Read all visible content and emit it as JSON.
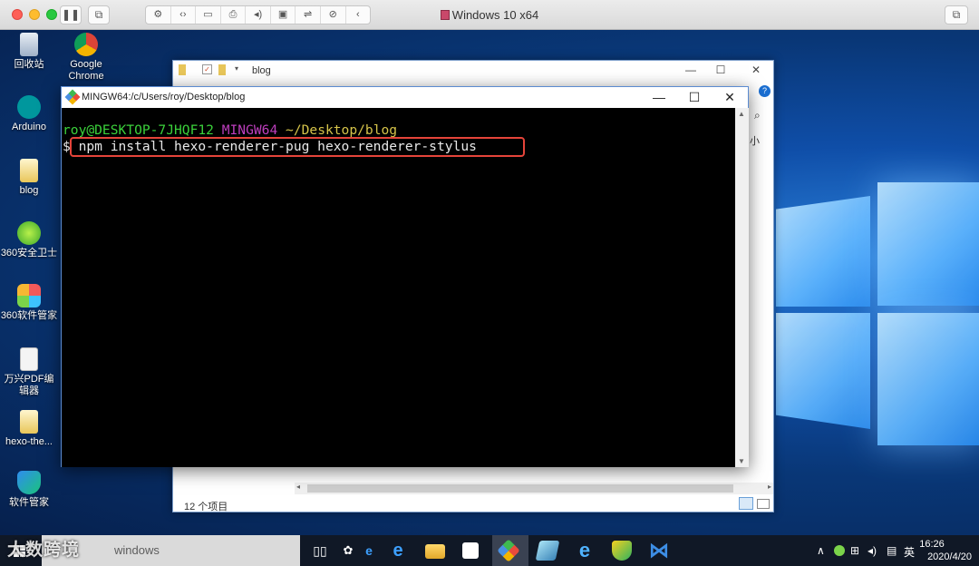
{
  "vm": {
    "title": "Windows 10 x64"
  },
  "desktop": {
    "icons": [
      {
        "label": "回收站"
      },
      {
        "label": "Google Chrome"
      },
      {
        "label": "Arduino"
      },
      {
        "label": "blog"
      },
      {
        "label": "360安全卫士"
      },
      {
        "label": "360软件管家"
      },
      {
        "label": "万兴PDF编辑器"
      },
      {
        "label": "hexo-the..."
      },
      {
        "label": "软件管家"
      }
    ]
  },
  "explorer": {
    "title": "blog",
    "side_char": "小",
    "status": "12 个项目"
  },
  "terminal": {
    "title": "MINGW64:/c/Users/roy/Desktop/blog",
    "prompt_user": "roy@DESKTOP-7JHQF12",
    "prompt_env": "MINGW64",
    "prompt_path": "~/Desktop/blog",
    "prompt_symbol": "$",
    "command": "npm install hexo-renderer-pug hexo-renderer-stylus"
  },
  "taskbar": {
    "search_placeholder": "windows",
    "watermark": "大数跨境",
    "ime": "英",
    "clock_time": "16:26",
    "clock_date": "2020/4/20"
  }
}
